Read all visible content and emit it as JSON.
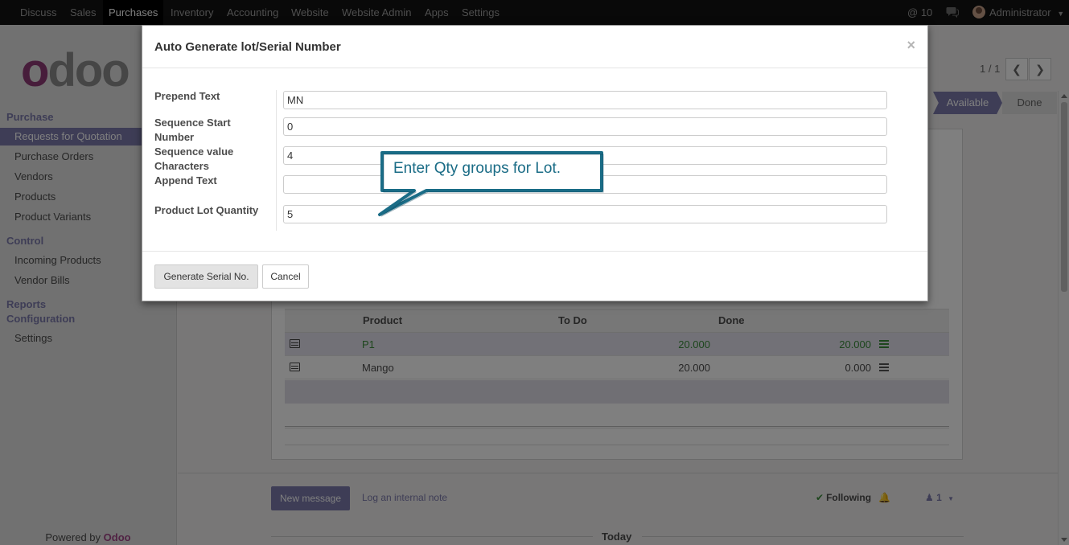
{
  "navbar": {
    "apps": [
      "Discuss",
      "Sales",
      "Purchases",
      "Inventory",
      "Accounting",
      "Website",
      "Website Admin",
      "Apps",
      "Settings"
    ],
    "active_app": "Purchases",
    "notification_count": "10",
    "user": "Administrator"
  },
  "sidebar": {
    "logo": "odoo",
    "sections": [
      {
        "title": "Purchase",
        "items": [
          "Requests for Quotation",
          "Purchase Orders",
          "Vendors",
          "Products",
          "Product Variants"
        ]
      },
      {
        "title": "Control",
        "items": [
          "Incoming Products",
          "Vendor Bills"
        ]
      },
      {
        "title": "Reports",
        "items": []
      },
      {
        "title": "Configuration",
        "items": [
          "Settings"
        ]
      }
    ],
    "active_item": "Requests for Quotation",
    "powered_by": "Powered by",
    "powered_brand": "Odoo"
  },
  "record": {
    "pager": "1 / 1",
    "status_steps": [
      "Available",
      "Done"
    ],
    "active_status": "Available"
  },
  "operations_table": {
    "headers": [
      "Product",
      "To Do",
      "Done"
    ],
    "rows": [
      {
        "product": "P1",
        "todo": "20.000",
        "done": "20.000"
      },
      {
        "product": "Mango",
        "todo": "20.000",
        "done": "0.000"
      }
    ]
  },
  "chatter": {
    "new_message": "New message",
    "log_note": "Log an internal note",
    "following": "Following",
    "followers": "1",
    "today": "Today"
  },
  "dialog": {
    "title": "Auto Generate lot/Serial Number",
    "close": "×",
    "fields": {
      "prepend_text": {
        "label": "Prepend Text",
        "value": "MN"
      },
      "sequence_start": {
        "label": "Sequence Start Number",
        "value": "0"
      },
      "sequence_chars": {
        "label": "Sequence value Characters",
        "value": "4"
      },
      "append_text": {
        "label": "Append Text",
        "value": ""
      },
      "lot_quantity": {
        "label": "Product Lot Quantity",
        "value": "5"
      }
    },
    "buttons": {
      "generate": "Generate Serial No.",
      "cancel": "Cancel"
    }
  },
  "callout": {
    "text": "Enter Qty groups for Lot."
  },
  "colors": {
    "brand": "#7c7bad",
    "navbar": "#121212",
    "callout_border": "#1a6c86"
  }
}
